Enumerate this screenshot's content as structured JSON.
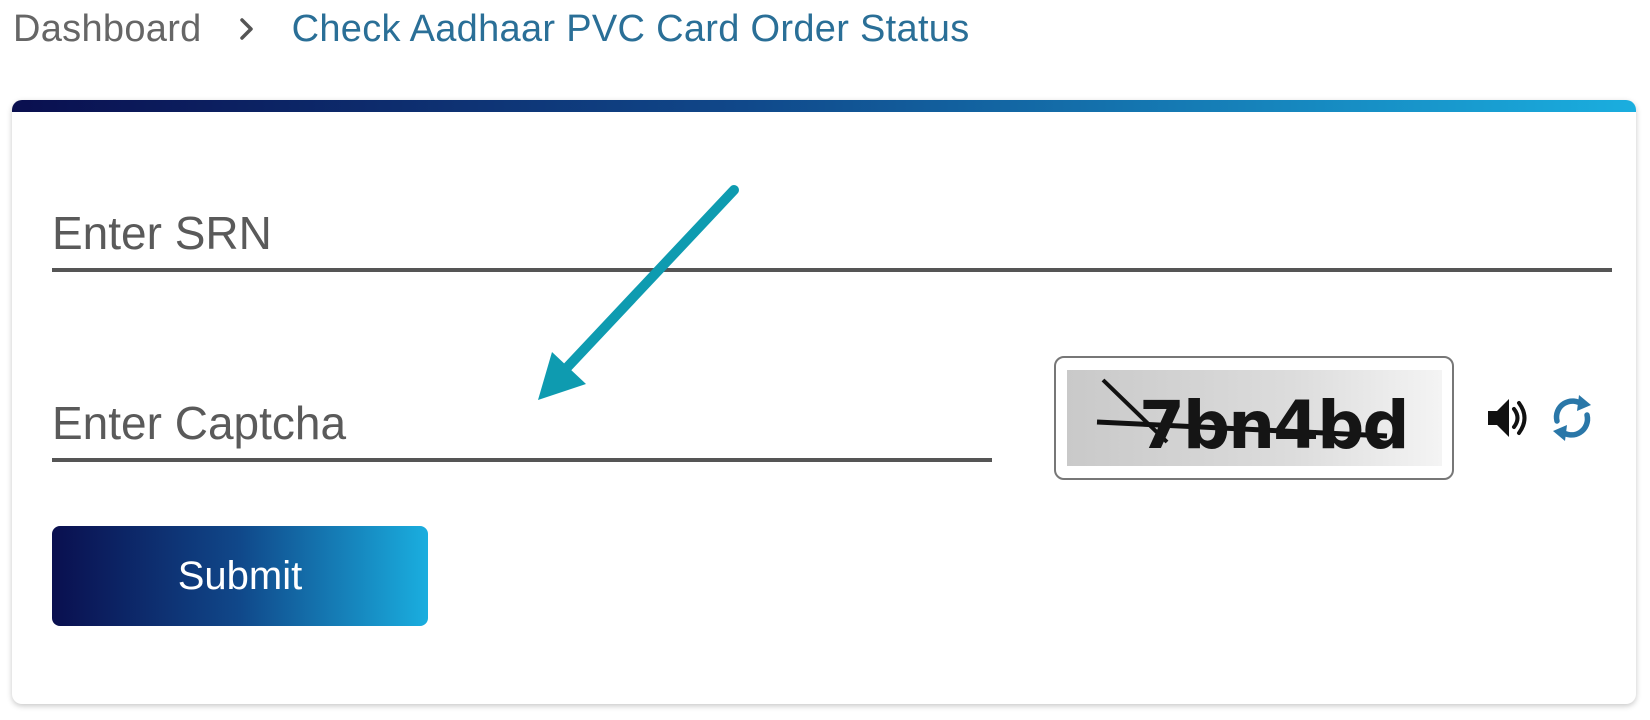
{
  "breadcrumb": {
    "home": "Dashboard",
    "current": "Check Aadhaar PVC Card Order Status"
  },
  "form": {
    "srn_placeholder": "Enter SRN",
    "srn_value": "",
    "captcha_placeholder": "Enter Captcha",
    "captcha_value": "",
    "captcha_text": "7bn4bd",
    "submit_label": "Submit"
  },
  "icons": {
    "audio": "speaker-icon",
    "refresh": "refresh-icon",
    "annotation": "arrow-annotation"
  },
  "colors": {
    "accent": "#2a6f97",
    "gradient_start": "#0a0f4f",
    "gradient_end": "#1aaedf",
    "arrow": "#0e9bb0"
  }
}
